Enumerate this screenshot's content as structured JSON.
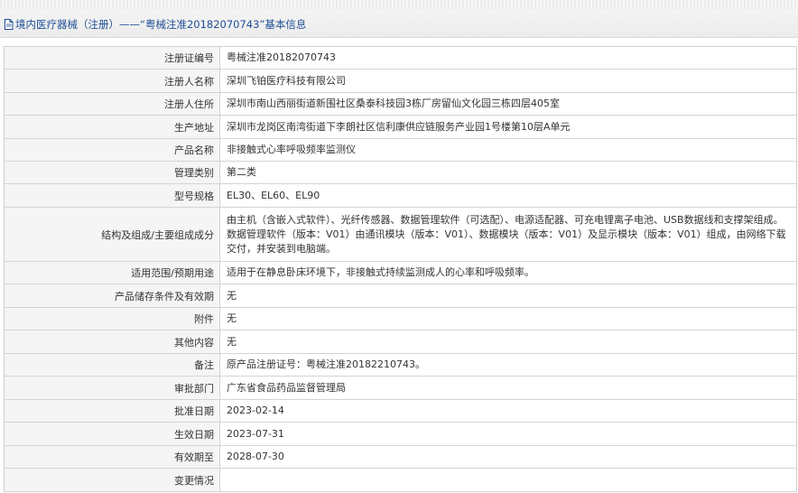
{
  "header": {
    "title": "境内医疗器械（注册）——“粤械注准20182070743”基本信息",
    "icon": "document-icon",
    "title_color": "#1f4e96"
  },
  "rows": [
    {
      "label": "注册证编号",
      "value": "粤械注准20182070743"
    },
    {
      "label": "注册人名称",
      "value": "深圳飞铂医疗科技有限公司"
    },
    {
      "label": "注册人住所",
      "value": "深圳市南山西丽街道新围社区桑泰科技园3栋厂房留仙文化园三栋四层405室"
    },
    {
      "label": "生产地址",
      "value": "深圳市龙岗区南湾街道下李朗社区信利康供应链服务产业园1号楼第10层A单元"
    },
    {
      "label": "产品名称",
      "value": "非接触式心率呼吸频率监测仪"
    },
    {
      "label": "管理类别",
      "value": "第二类"
    },
    {
      "label": "型号规格",
      "value": "EL30、EL60、EL90"
    },
    {
      "label": "结构及组成/主要组成成分",
      "value": "由主机（含嵌入式软件）、光纤传感器、数据管理软件（可选配）、电源适配器、可充电锂离子电池、USB数据线和支撑架组成。数据管理软件（版本：V01）由通讯模块（版本：V01）、数据模块（版本：V01）及显示模块（版本：V01）组成，由网络下载交付，并安装到电脑端。"
    },
    {
      "label": "适用范围/预期用途",
      "value": "适用于在静息卧床环境下，非接触式持续监测成人的心率和呼吸频率。"
    },
    {
      "label": "产品储存条件及有效期",
      "value": "无"
    },
    {
      "label": "附件",
      "value": "无"
    },
    {
      "label": "其他内容",
      "value": "无"
    },
    {
      "label": "备注",
      "value": "原产品注册证号：粤械注准20182210743。"
    },
    {
      "label": "审批部门",
      "value": "广东省食品药品监督管理局"
    },
    {
      "label": "批准日期",
      "value": "2023-02-14"
    },
    {
      "label": "生效日期",
      "value": "2023-07-31"
    },
    {
      "label": "有效期至",
      "value": "2028-07-30"
    },
    {
      "label": "变更情况",
      "value": ""
    }
  ]
}
